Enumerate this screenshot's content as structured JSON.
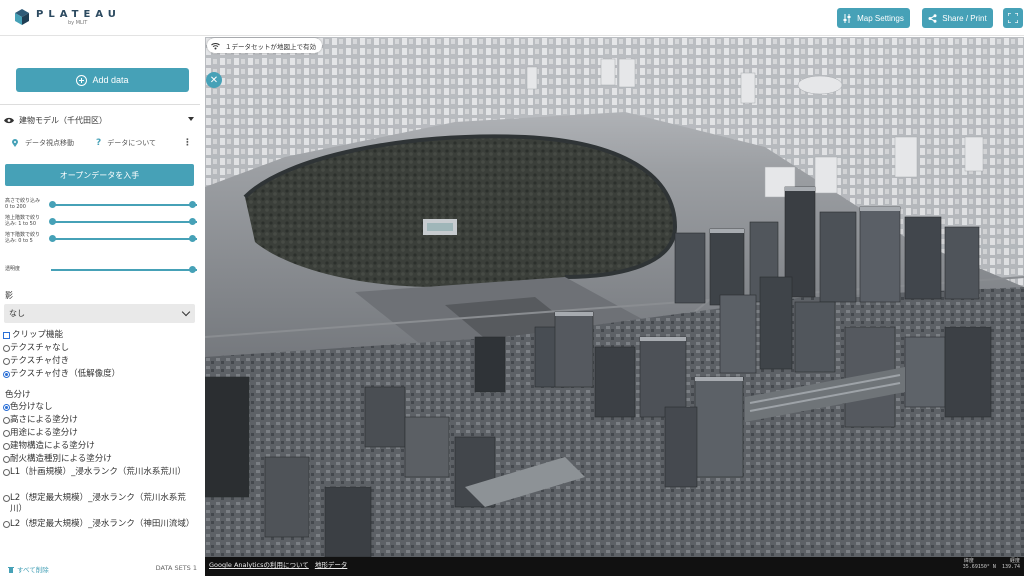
{
  "header": {
    "logo_title": "PLATEAU",
    "logo_sub": "by MLIT",
    "map_settings_label": "Map Settings",
    "share_print_label": "Share / Print",
    "accent_color": "#46a1b7"
  },
  "sidebar": {
    "add_data_label": "Add data",
    "layer": {
      "name": "建物モデル（千代田区）",
      "move_to_data_label": "データ視点移動",
      "about_data_label": "データについて",
      "open_data_button": "オープンデータを入手"
    },
    "sliders": [
      {
        "label_line1": "高さで絞り込み",
        "label_line2": "0 to 200",
        "value_low": 0,
        "value_high": 1
      },
      {
        "label_line1": "地上階数で絞り",
        "label_line2": "込み: 1 to 50",
        "value_low": 0,
        "value_high": 1
      },
      {
        "label_line1": "地下階数で絞り",
        "label_line2": "込み: 0 to 5",
        "value_low": 0,
        "value_high": 1
      }
    ],
    "opacity_label": "透明度",
    "opacity_value": 1,
    "shadow_label": "影",
    "shadow_selected": "なし",
    "clip_label": "クリップ機能",
    "texture_options": [
      "テクスチャなし",
      "テクスチャ付き",
      "テクスチャ付き（低解像度）"
    ],
    "texture_selected_index": 2,
    "color_section_label": "色分け",
    "color_options": [
      "色分けなし",
      "高さによる塗分け",
      "用途による塗分け",
      "建物構造による塗分け",
      "耐火構造種別による塗分け",
      "L1（計画規模）_浸水ランク（荒川水系荒川）",
      "L2（想定最大規模）_浸水ランク（荒川水系荒川）",
      "L2（想定最大規模）_浸水ランク（神田川流域）"
    ],
    "color_selected_index": 0,
    "clear_all_label": "すべて削除",
    "datasets_label": "DATA SETS 1"
  },
  "map": {
    "status_text": "１データセットが地図上で有効",
    "attributions": [
      "Google Analyticsの利用について",
      "地形データ"
    ],
    "coord_lat_label": "緯度",
    "coord_lat_value": "35.69150° N",
    "coord_lon_label": "経度",
    "coord_lon_value": "139.74"
  }
}
